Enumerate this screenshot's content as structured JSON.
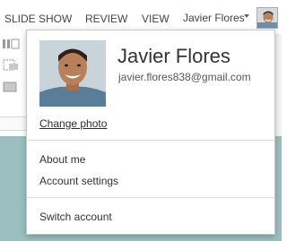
{
  "ribbon": {
    "tabs": [
      "SLIDE SHOW",
      "REVIEW",
      "VIEW"
    ],
    "user_name": "Javier Flores"
  },
  "account_menu": {
    "name": "Javier Flores",
    "email": "javier.flores838@gmail.com",
    "change_photo_label": "Change photo",
    "items": [
      "About me",
      "Account settings",
      "Switch account"
    ]
  },
  "icons": {
    "caret": "chevron-down-icon",
    "avatar": "user-photo"
  },
  "colors": {
    "slide_background": "#9bbfbf",
    "panel_border": "#c6c6c6"
  }
}
